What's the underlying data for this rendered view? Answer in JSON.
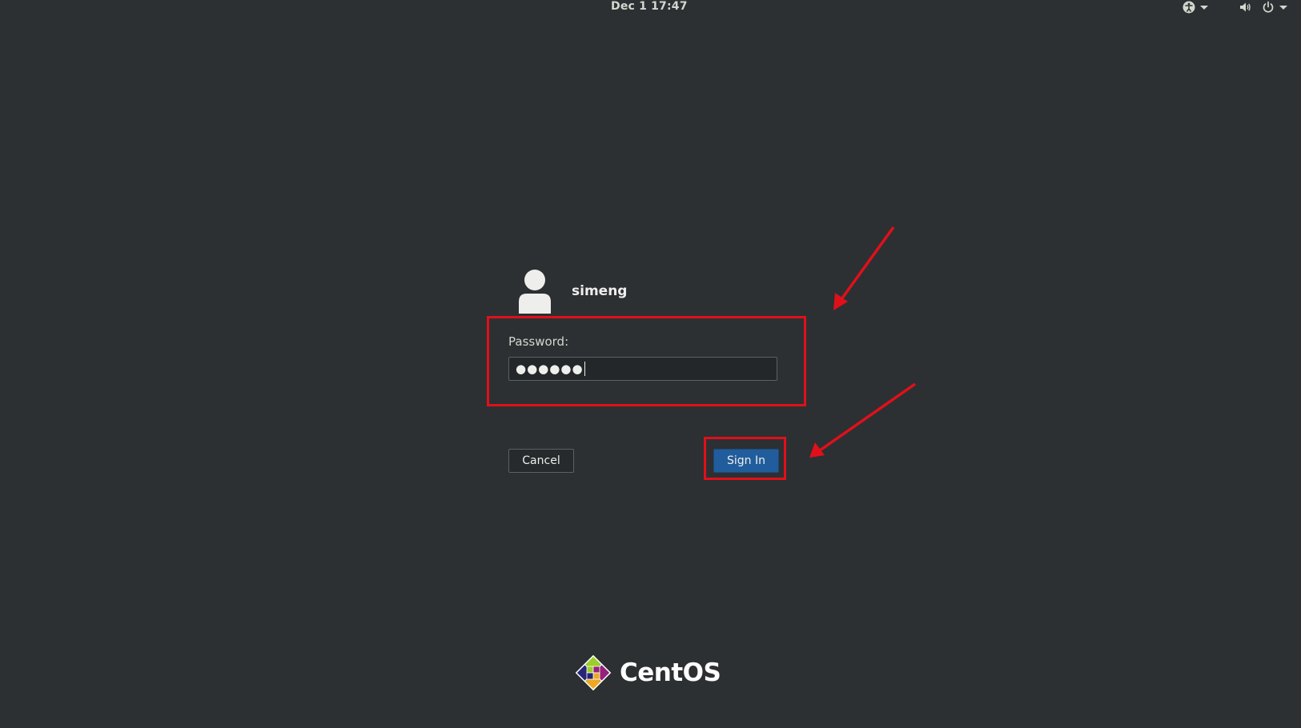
{
  "topbar": {
    "clock": "Dec 1  17:47",
    "icons": [
      "accessibility-icon",
      "volume-icon",
      "power-icon"
    ]
  },
  "login": {
    "username": "simeng",
    "password_label": "Password:",
    "password_mask": "●●●●●●",
    "cancel_label": "Cancel",
    "signin_label": "Sign In"
  },
  "branding": {
    "logo_text": "CentOS"
  },
  "colors": {
    "background": "#2c3032",
    "accent": "#215d9c",
    "annotation": "#e0101a"
  }
}
